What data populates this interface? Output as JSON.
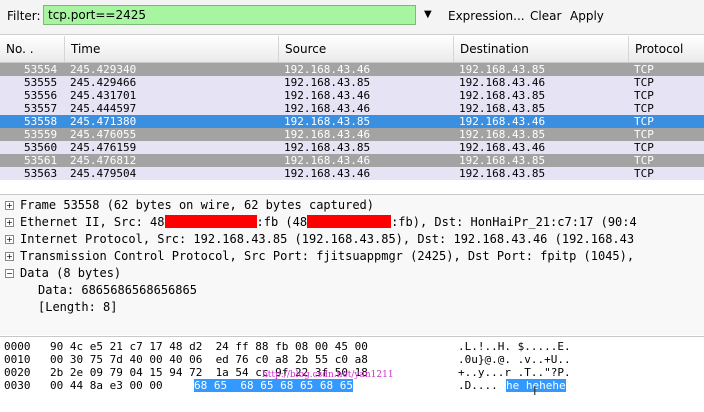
{
  "filter": {
    "label": "Filter:",
    "value": "tcp.port==2425",
    "dropdown": "▼",
    "expression": "Expression...",
    "clear": "Clear",
    "apply": "Apply"
  },
  "columns": [
    "No. .",
    "Time",
    "Source",
    "Destination",
    "Protocol"
  ],
  "packets": [
    {
      "no": "53554",
      "time": "245.429340",
      "src": "192.168.43.46",
      "dst": "192.168.43.85",
      "proto": "TCP",
      "bg": "#a3a3a3",
      "fg": "#ffffff"
    },
    {
      "no": "53555",
      "time": "245.429466",
      "src": "192.168.43.85",
      "dst": "192.168.43.46",
      "proto": "TCP",
      "bg": "#e6e4f4",
      "fg": "#000000"
    },
    {
      "no": "53556",
      "time": "245.431701",
      "src": "192.168.43.46",
      "dst": "192.168.43.85",
      "proto": "TCP",
      "bg": "#e6e4f4",
      "fg": "#000000"
    },
    {
      "no": "53557",
      "time": "245.444597",
      "src": "192.168.43.46",
      "dst": "192.168.43.85",
      "proto": "TCP",
      "bg": "#e6e4f4",
      "fg": "#000000"
    },
    {
      "no": "53558",
      "time": "245.471380",
      "src": "192.168.43.85",
      "dst": "192.168.43.46",
      "proto": "TCP",
      "bg": "#3a8fe0",
      "fg": "#ffffff"
    },
    {
      "no": "53559",
      "time": "245.476055",
      "src": "192.168.43.46",
      "dst": "192.168.43.85",
      "proto": "TCP",
      "bg": "#a3a3a3",
      "fg": "#ffffff"
    },
    {
      "no": "53560",
      "time": "245.476159",
      "src": "192.168.43.85",
      "dst": "192.168.43.46",
      "proto": "TCP",
      "bg": "#e6e4f4",
      "fg": "#000000"
    },
    {
      "no": "53561",
      "time": "245.476812",
      "src": "192.168.43.46",
      "dst": "192.168.43.85",
      "proto": "TCP",
      "bg": "#a3a3a3",
      "fg": "#ffffff"
    },
    {
      "no": "53563",
      "time": "245.479504",
      "src": "192.168.43.46",
      "dst": "192.168.43.85",
      "proto": "TCP",
      "bg": "#e6e4f4",
      "fg": "#000000"
    }
  ],
  "details": {
    "frame": "Frame 53558 (62 bytes on wire, 62 bytes captured)",
    "eth_a": "Ethernet II, Src: 48",
    "eth_b": ":fb (48",
    "eth_c": ":fb), Dst: HonHaiPr_21:c7:17 (90:4",
    "ip": "Internet Protocol, Src: 192.168.43.85 (192.168.43.85), Dst: 192.168.43.46 (192.168.43",
    "tcp": "Transmission Control Protocol, Src Port: fjitsuappmgr (2425), Dst Port: fpitp (1045),",
    "data": "Data (8 bytes)",
    "data_val": "Data: 6865686568656865",
    "data_len": "[Length: 8]",
    "plus": "+",
    "minus": "−"
  },
  "hex": [
    {
      "off": "0000",
      "bytes": "90 4c e5 21 c7 17 48 d2  24 ff 88 fb 08 00 45 00",
      "ascii": ".L.!..H. $.....E."
    },
    {
      "off": "0010",
      "bytes": "00 30 75 7d 40 00 40 06  ed 76 c0 a8 2b 55 c0 a8",
      "ascii": ".0u}@.@. .v..+U.."
    },
    {
      "off": "0020",
      "bytes": "2b 2e 09 79 04 15 94 72  1a 54 cc 9f 22 3f 50 18",
      "ascii": "+..y...r .T..\"?P."
    },
    {
      "off": "0030",
      "bytes_plain": "00 44 8a e3 00 00 ",
      "bytes_sel": "68 65  68 65 68 65 68 65",
      "ascii_plain": ".D....",
      "ascii_sel": "he hehehe"
    }
  ],
  "watermark": "http://blog.csdn.net/yan1211"
}
